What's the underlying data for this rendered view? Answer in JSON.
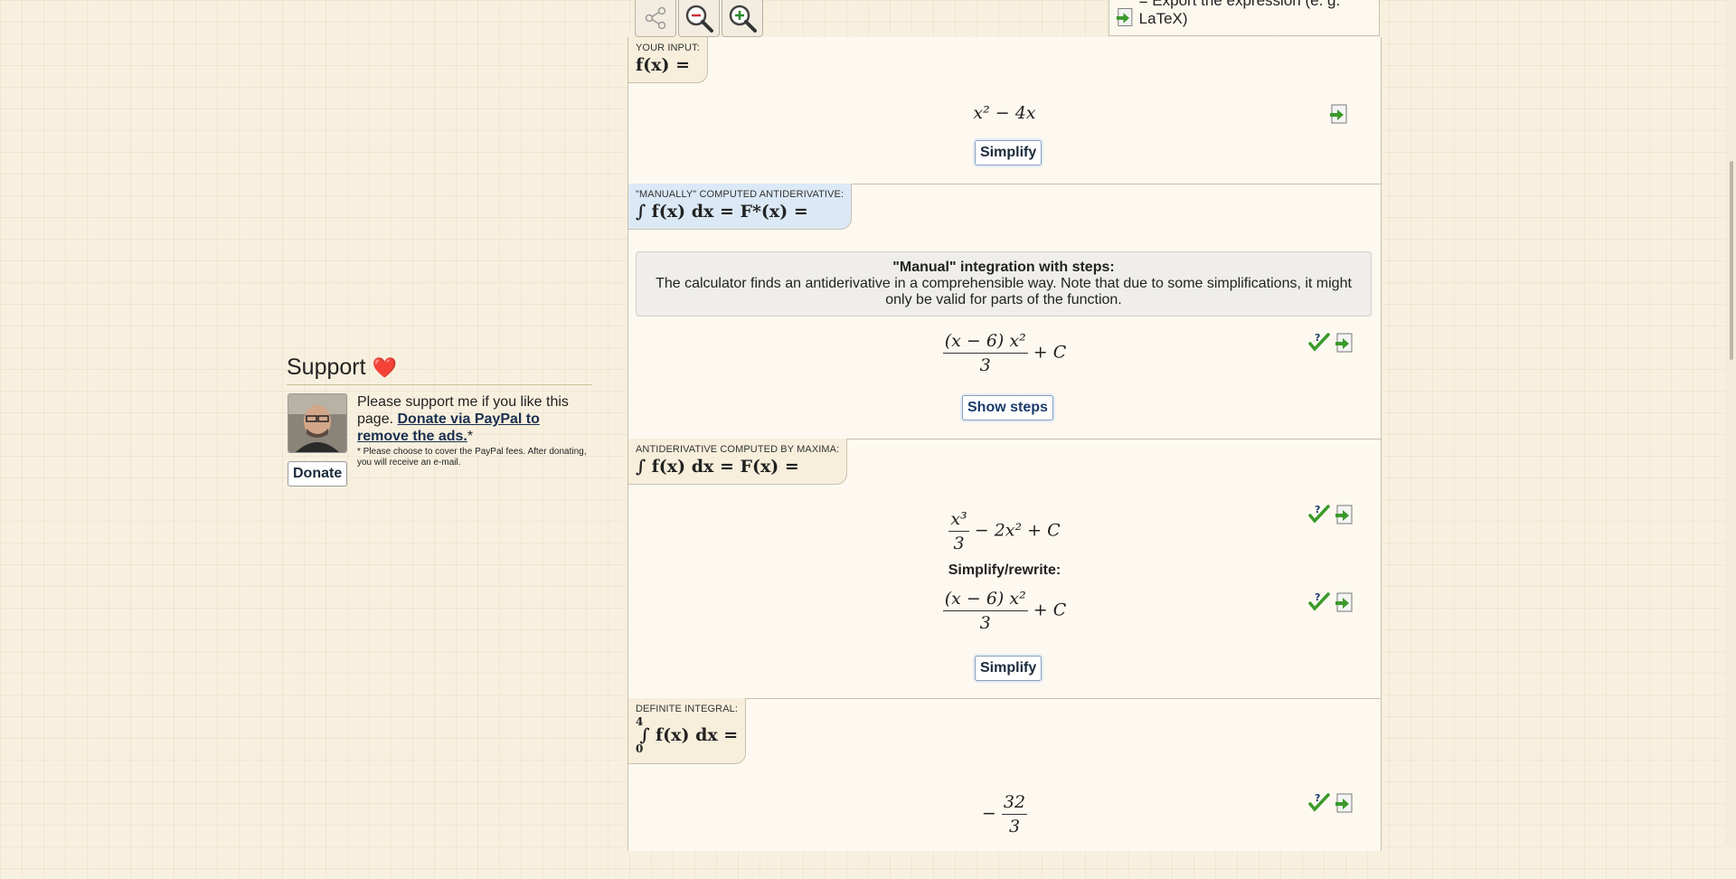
{
  "toolbar": {
    "share_icon": "share-icon",
    "zoom_out_icon": "zoom-out-icon",
    "zoom_in_icon": "zoom-in-icon"
  },
  "legend": {
    "export_text": "= Export the expression (e. g. LaTeX)"
  },
  "input_section": {
    "label": "YOUR INPUT:",
    "formula": "f(x) =",
    "expression": "x² − 4x",
    "simplify_label": "Simplify"
  },
  "manual_section": {
    "label": "\"MANUALLY\" COMPUTED ANTIDERIVATIVE:",
    "formula": "∫ f(x) dx = F*(x) =",
    "info_title": "\"Manual\" integration with steps:",
    "info_text": "The calculator finds an antiderivative in a comprehensible way. Note that due to some simplifications, it might only be valid for parts of the function.",
    "result_num": "(x − 6) x²",
    "result_den": "3",
    "result_tail": "+ C",
    "show_steps_label": "Show steps"
  },
  "maxima_section": {
    "label": "ANTIDERIVATIVE COMPUTED BY MAXIMA:",
    "formula": "∫ f(x) dx = F(x) =",
    "result_num": "x³",
    "result_den": "3",
    "result_tail": "− 2x² + C",
    "simplify_rewrite_label": "Simplify/rewrite:",
    "rewrite_num": "(x − 6) x²",
    "rewrite_den": "3",
    "rewrite_tail": "+ C",
    "simplify_label": "Simplify"
  },
  "definite_section": {
    "label": "DEFINITE INTEGRAL:",
    "upper": "4",
    "lower": "0",
    "formula": "∫ f(x) dx =",
    "result_sign": "−",
    "result_num": "32",
    "result_den": "3"
  },
  "support": {
    "title": "Support",
    "heart": "❤️",
    "text": "Please support me if you like this page.",
    "link": "Donate via PayPal to remove the ads.",
    "asterisk": "*",
    "note": "* Please choose to cover the PayPal fees. After donating, you will receive an e-mail.",
    "donate_label": "Donate"
  },
  "colors": {
    "page_bg": "#f8f0df",
    "tab_bg": "#f7efdc",
    "tab_blue": "#dbe9f6",
    "check_green": "#3a9a2a"
  }
}
